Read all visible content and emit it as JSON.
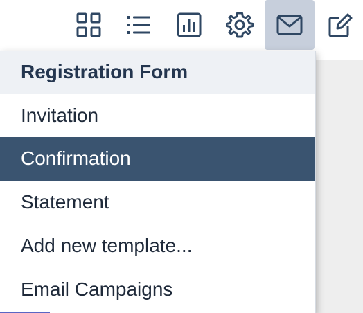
{
  "colors": {
    "accent": "#3a5470",
    "active_button_bg": "#c7cfdc",
    "header_bg": "#eef1f5",
    "icon": "#2f4763"
  },
  "toolbar": {
    "buttons": [
      {
        "icon": "grid-icon",
        "active": false
      },
      {
        "icon": "list-icon",
        "active": false
      },
      {
        "icon": "chart-icon",
        "active": false
      },
      {
        "icon": "gear-icon",
        "active": false
      },
      {
        "icon": "mail-icon",
        "active": true
      },
      {
        "icon": "edit-icon",
        "active": false
      }
    ]
  },
  "menu": {
    "header": "Registration Form",
    "templates": [
      "Invitation",
      "Confirmation",
      "Statement"
    ],
    "selected": "Confirmation",
    "actions": [
      "Add new template...",
      "Email Campaigns"
    ]
  }
}
